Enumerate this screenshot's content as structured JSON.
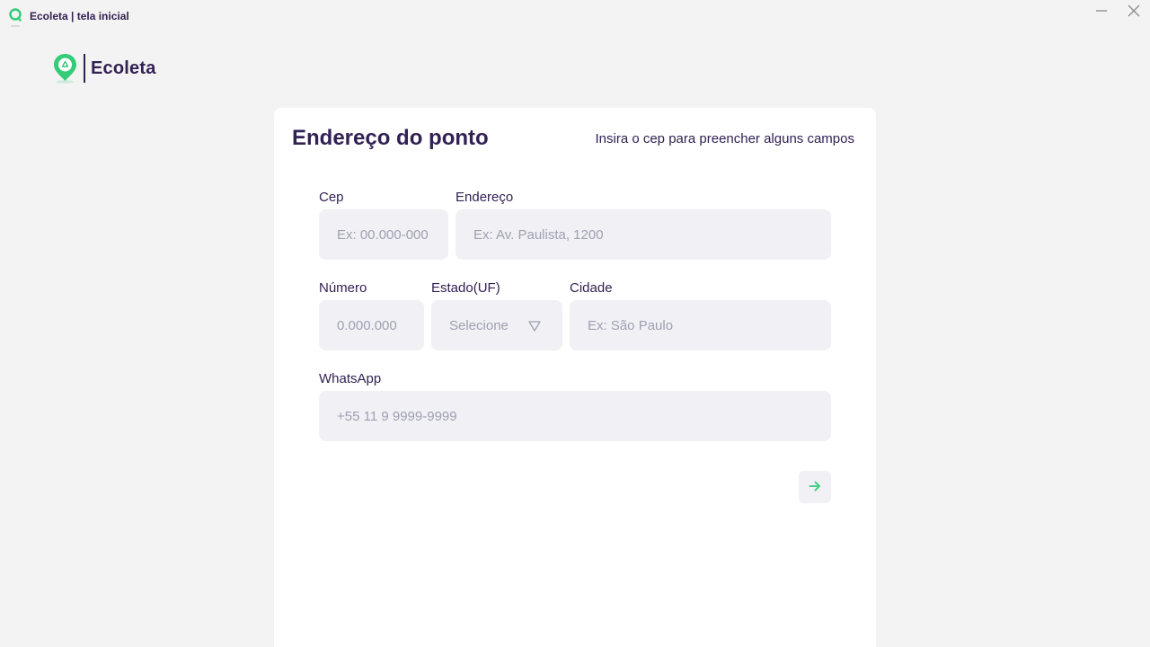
{
  "window": {
    "title": "Ecoleta | tela inicial",
    "app_icon": "location-pin-icon",
    "minimize_icon": "minimize-icon",
    "close_icon": "close-icon"
  },
  "header": {
    "brand": "Ecoleta",
    "logo_icon": "recycle-pin-icon"
  },
  "form": {
    "title": "Endereço do ponto",
    "hint": "Insira o cep para preencher alguns campos",
    "cep": {
      "label": "Cep",
      "placeholder": "Ex: 00.000-000",
      "value": ""
    },
    "endereco": {
      "label": "Endereço",
      "placeholder": "Ex: Av. Paulista, 1200",
      "value": ""
    },
    "numero": {
      "label": "Número",
      "placeholder": "0.000.000",
      "value": ""
    },
    "estado": {
      "label": "Estado(UF)",
      "selected": "Selecione"
    },
    "cidade": {
      "label": "Cidade",
      "placeholder": "Ex: São Paulo",
      "value": ""
    },
    "whatsapp": {
      "label": "WhatsApp",
      "placeholder": "+55 11 9 9999-9999",
      "value": ""
    },
    "next_icon": "arrow-right-icon"
  },
  "colors": {
    "primary": "#322153",
    "accent": "#34cb79",
    "input_bg": "#f0f0f5",
    "placeholder": "#a0a0b2",
    "page_bg": "#f3f3f3"
  }
}
